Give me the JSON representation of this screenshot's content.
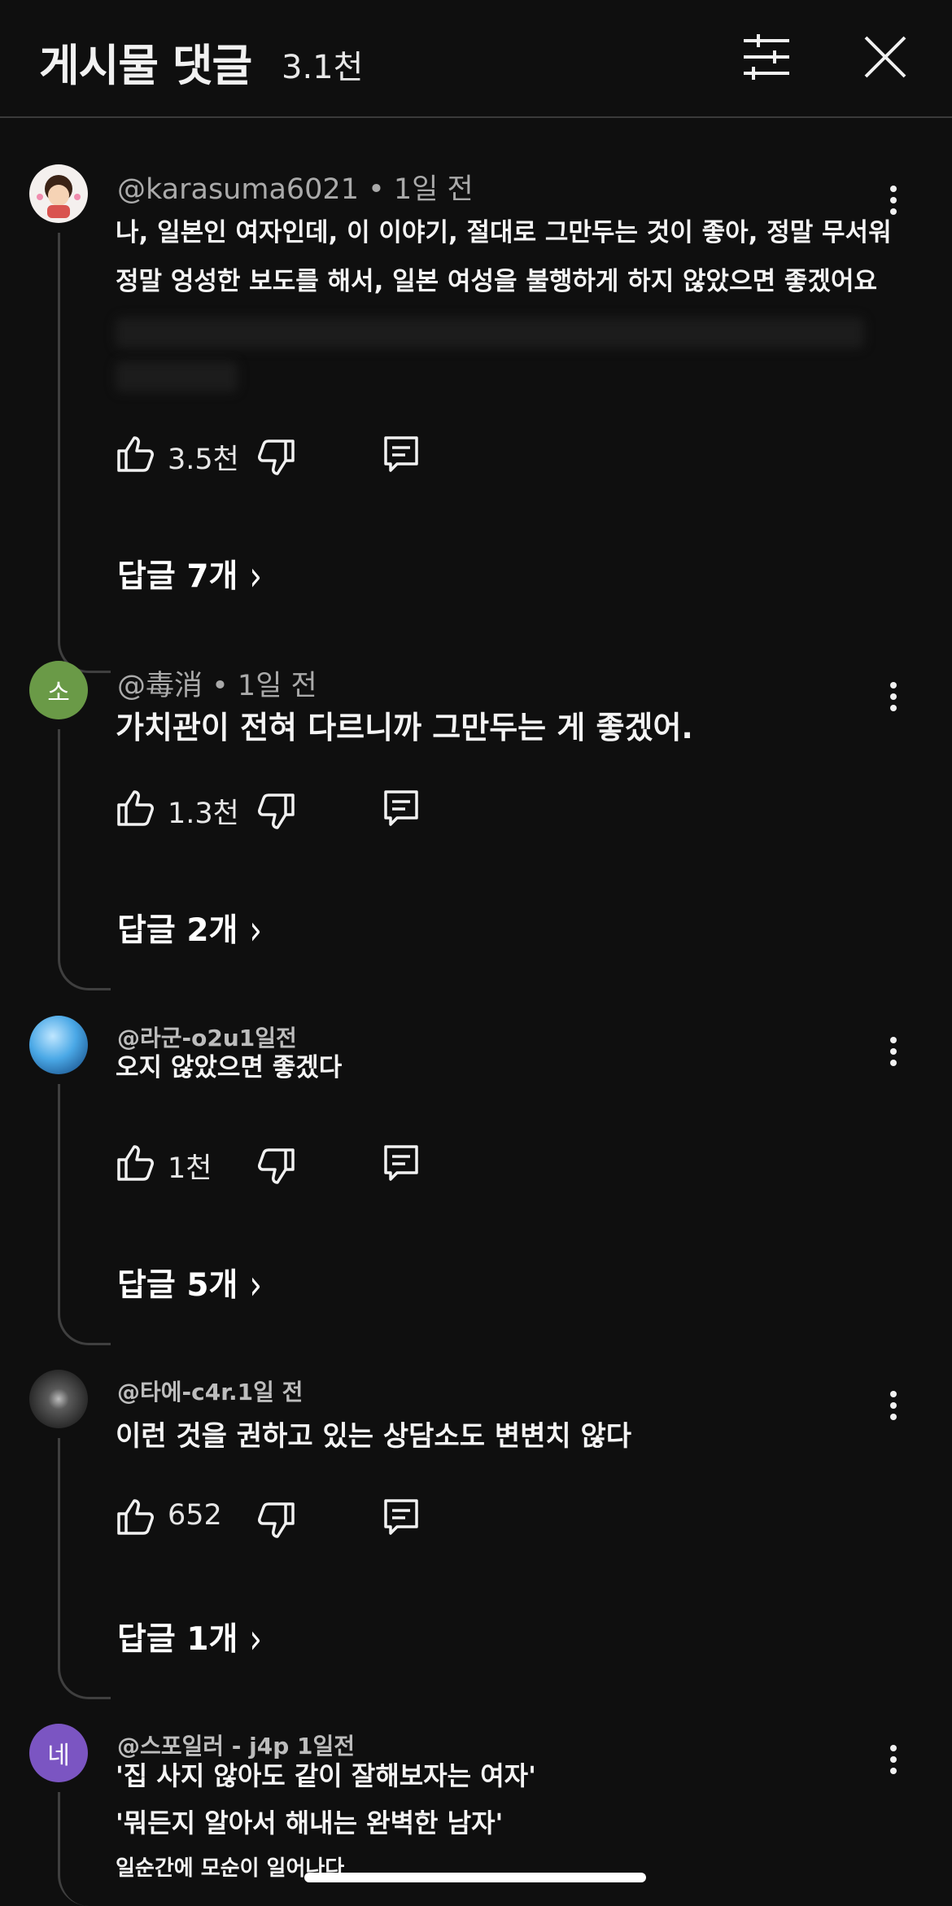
{
  "header": {
    "title": "게시물 댓글",
    "count": "3.1천"
  },
  "comments": [
    {
      "avatar_text": "",
      "avatar_color": "#f4f0ee",
      "author": "@karasuma6021",
      "time": "• 1일 전",
      "lines": [
        "나, 일본인 여자인데, 이 이야기, 절대로 그만두는 것이 좋아, 정말 무서워",
        "정말 엉성한 보도를 해서, 일본 여성을 불행하게 하지 않았으면 좋겠어요"
      ],
      "likes": "3.5천",
      "replies": "답글 7개"
    },
    {
      "avatar_text": "소",
      "avatar_color": "#6a9a47",
      "author": "@毒消",
      "time": "• 1일 전",
      "lines": [
        "가치관이 전혀 다르니까 그만두는 게 좋겠어."
      ],
      "likes": "1.3천",
      "replies": "답글 2개"
    },
    {
      "avatar_text": "",
      "avatar_color": "#2e7fbf",
      "author": "@라군-o2u1일전",
      "time": "",
      "lines": [
        "오지 않았으면 좋겠다"
      ],
      "likes": "1천",
      "replies": "답글 5개"
    },
    {
      "avatar_text": "",
      "avatar_color": "#4a4a4a",
      "author": "@타에-c4r.1일 전",
      "time": "",
      "lines": [
        "이런 것을 권하고 있는 상담소도 변변치 않다"
      ],
      "likes": "652",
      "replies": "답글 1개"
    },
    {
      "avatar_text": "네",
      "avatar_color": "#7b55c2",
      "author": "@스포일러 - j4p 1일전",
      "time": "",
      "lines": [
        "'집 사지 않아도 같이 잘해보자는 여자'",
        "'뭐든지 알아서 해내는 완벽한 남자'",
        "일순간에 모순이 일어나다"
      ],
      "likes": "",
      "replies": ""
    }
  ],
  "icons": {
    "filter": "sliders-icon",
    "close": "close-icon",
    "more": "more-vert-icon",
    "like": "thumb-up-icon",
    "dislike": "thumb-down-icon",
    "reply": "reply-comment-icon"
  }
}
